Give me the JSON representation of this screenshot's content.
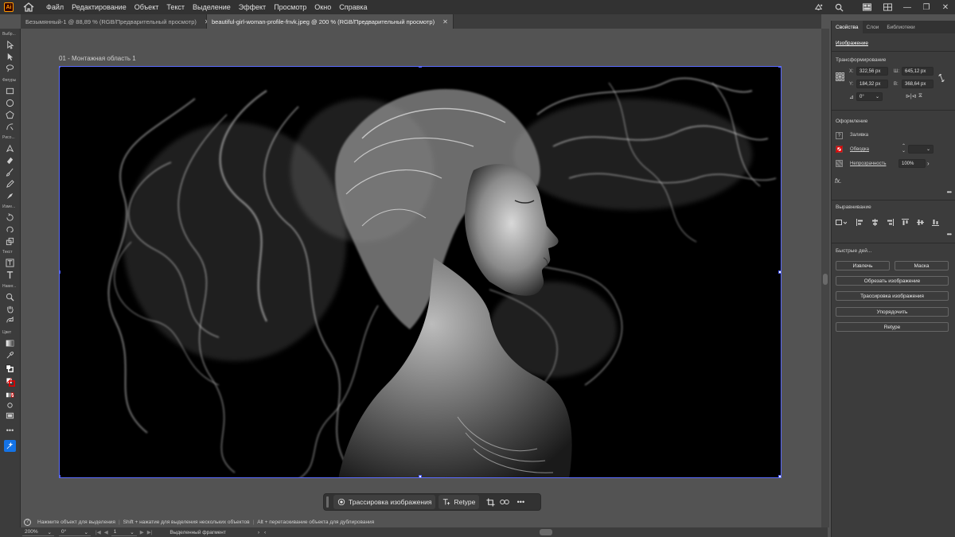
{
  "app": {
    "logo": "Ai"
  },
  "menu": [
    "Файл",
    "Редактирование",
    "Объект",
    "Текст",
    "Выделение",
    "Эффект",
    "Просмотр",
    "Окно",
    "Справка"
  ],
  "tabs": [
    {
      "label": "Безымянный-1 @ 88,89 % (RGB/Предварительный просмотр)",
      "active": false
    },
    {
      "label": "beautiful-girl-woman-profile-fnvk.jpeg @ 200 % (RGB/Предварительный просмотр)",
      "active": true
    }
  ],
  "toolbar": {
    "labels": [
      "Выбр...",
      "Фигуры",
      "Рисо...",
      "Изме...",
      "Текст",
      "Навиг...",
      "Цвет"
    ]
  },
  "artboard": {
    "label": "01 - Монтажная область 1"
  },
  "taskbar": {
    "trace_label": "Трассировка изображения",
    "retype_label": "Retype"
  },
  "hints": {
    "h1": "Нажмите объект для выделения",
    "h2": "Shift + нажатие для выделения нескольких объектов",
    "h3": "Alt + перетаскивание объекта для дублирования"
  },
  "status": {
    "zoom": "200%",
    "rotation": "0°",
    "artboard_num": "1",
    "mode": "Выделенный фрагмент"
  },
  "panel": {
    "tabs": [
      "Свойства",
      "Слои",
      "Библиотеки"
    ],
    "object_type": "Изображение",
    "transform_title": "Трансформирование",
    "x_label": "X:",
    "x_value": "322,56 px",
    "w_label": "Ш:",
    "w_value": "645,12 px",
    "y_label": "Y:",
    "y_value": "184,32 px",
    "h_label": "В:",
    "h_value": "368,64 px",
    "angle_value": "0°",
    "appearance_title": "Оформление",
    "fill_label": "Заливка",
    "stroke_label": "Обводка",
    "opacity_label": "Непрозрачность",
    "opacity_value": "100%",
    "fx_label": "fx.",
    "align_title": "Выравнивание",
    "quick_title": "Быстрые дей...",
    "btn_extract": "Извлечь",
    "btn_mask": "Маска",
    "btn_crop": "Обрезать изображение",
    "btn_trace": "Трассировка изображения",
    "btn_arrange": "Упорядочить",
    "btn_retype": "Retype"
  },
  "colors": {
    "accent": "#1473e6",
    "artboard_border": "#5b6bff",
    "panel_bg": "#3c3c3c",
    "canvas_bg": "#535353"
  },
  "image": {
    "description_icon": "smoke-woman-portrait-image"
  }
}
